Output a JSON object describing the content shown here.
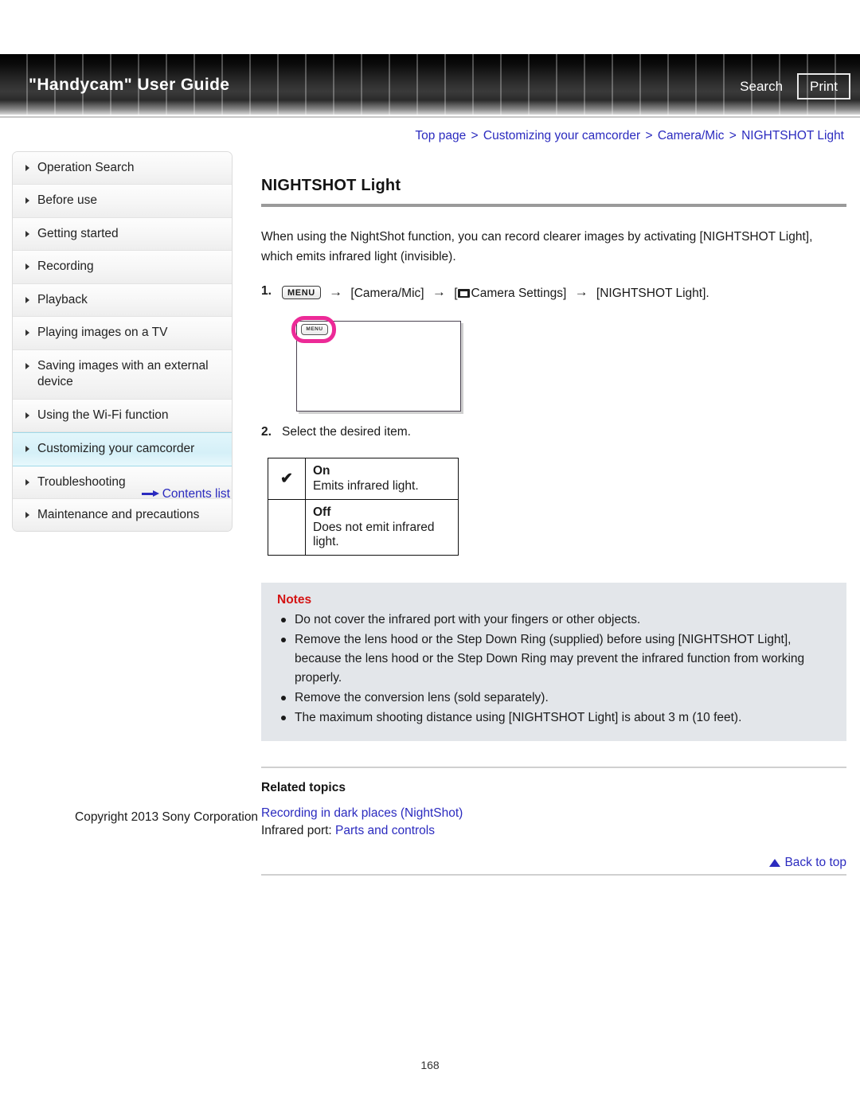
{
  "header": {
    "title": "\"Handycam\" User Guide",
    "search_label": "Search",
    "print_label": "Print"
  },
  "breadcrumb": {
    "items": [
      "Top page",
      "Customizing your camcorder",
      "Camera/Mic",
      "NIGHTSHOT Light"
    ],
    "separator": ">"
  },
  "sidebar": {
    "items": [
      {
        "label": "Operation Search",
        "active": false
      },
      {
        "label": "Before use",
        "active": false
      },
      {
        "label": "Getting started",
        "active": false
      },
      {
        "label": "Recording",
        "active": false
      },
      {
        "label": "Playback",
        "active": false
      },
      {
        "label": "Playing images on a TV",
        "active": false
      },
      {
        "label": "Saving images with an external device",
        "active": false
      },
      {
        "label": "Using the Wi-Fi function",
        "active": false
      },
      {
        "label": "Customizing your camcorder",
        "active": true
      },
      {
        "label": "Troubleshooting",
        "active": false
      },
      {
        "label": "Maintenance and precautions",
        "active": false
      }
    ],
    "contents_link": "Contents list"
  },
  "main": {
    "title": "NIGHTSHOT Light",
    "intro": "When using the NightShot function, you can record clearer images by activating [NIGHTSHOT Light], which emits infrared light (invisible).",
    "step1": {
      "number": "1.",
      "menu_chip": "MENU",
      "arrow": "→",
      "part1": "[Camera/Mic]",
      "part2_open": "[",
      "part2": "Camera Settings]",
      "part3": "[NIGHTSHOT Light]."
    },
    "illustration": {
      "menu_button_label": "MENU",
      "highlight_color": "#ec2a97"
    },
    "step2": {
      "number": "2.",
      "text": "Select the desired item."
    },
    "options": [
      {
        "checked": "✔",
        "name": "On",
        "desc": "Emits infrared light."
      },
      {
        "checked": "",
        "name": "Off",
        "desc": "Does not emit infrared light."
      }
    ],
    "notes": {
      "title": "Notes",
      "color": "#d41414",
      "items": [
        "Do not cover the infrared port with your fingers or other objects.",
        "Remove the lens hood or the Step Down Ring (supplied) before using [NIGHTSHOT Light], because the lens hood or the Step Down Ring may prevent the infrared function from working properly.",
        "Remove the conversion lens (sold separately).",
        "The maximum shooting distance using [NIGHTSHOT Light] is about 3 m (10 feet)."
      ]
    },
    "related": {
      "title": "Related topics",
      "link1": "Recording in dark places (NightShot)",
      "line2_prefix": "Infrared port: ",
      "line2_link": "Parts and controls"
    },
    "back_to_top": "Back to top"
  },
  "footer": {
    "copyright": "Copyright 2013 Sony Corporation",
    "page_number": "168"
  }
}
